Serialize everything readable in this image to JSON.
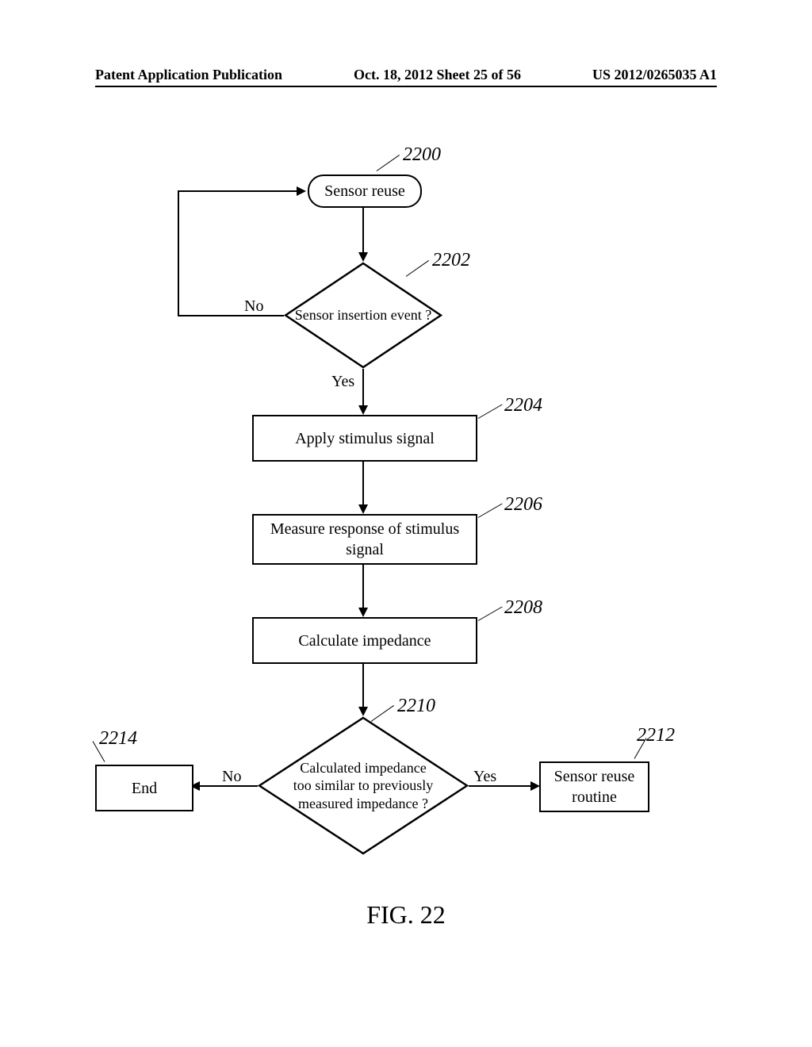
{
  "header": {
    "left": "Patent Application Publication",
    "center": "Oct. 18, 2012  Sheet 25 of 56",
    "right": "US 2012/0265035 A1"
  },
  "flowchart": {
    "start": {
      "label": "Sensor reuse",
      "ref": "2200"
    },
    "decision1": {
      "text": "Sensor insertion event ?",
      "ref": "2202",
      "no": "No",
      "yes": "Yes"
    },
    "step1": {
      "text": "Apply stimulus signal",
      "ref": "2204"
    },
    "step2": {
      "text": "Measure response of stimulus signal",
      "ref": "2206"
    },
    "step3": {
      "text": "Calculate impedance",
      "ref": "2208"
    },
    "decision2": {
      "text": "Calculated impedance too similar to previously measured impedance ?",
      "ref": "2210",
      "no": "No",
      "yes": "Yes"
    },
    "end": {
      "text": "End",
      "ref": "2214"
    },
    "reuse": {
      "text": "Sensor reuse routine",
      "ref": "2212"
    }
  },
  "figure": {
    "caption": "FIG. 22"
  }
}
